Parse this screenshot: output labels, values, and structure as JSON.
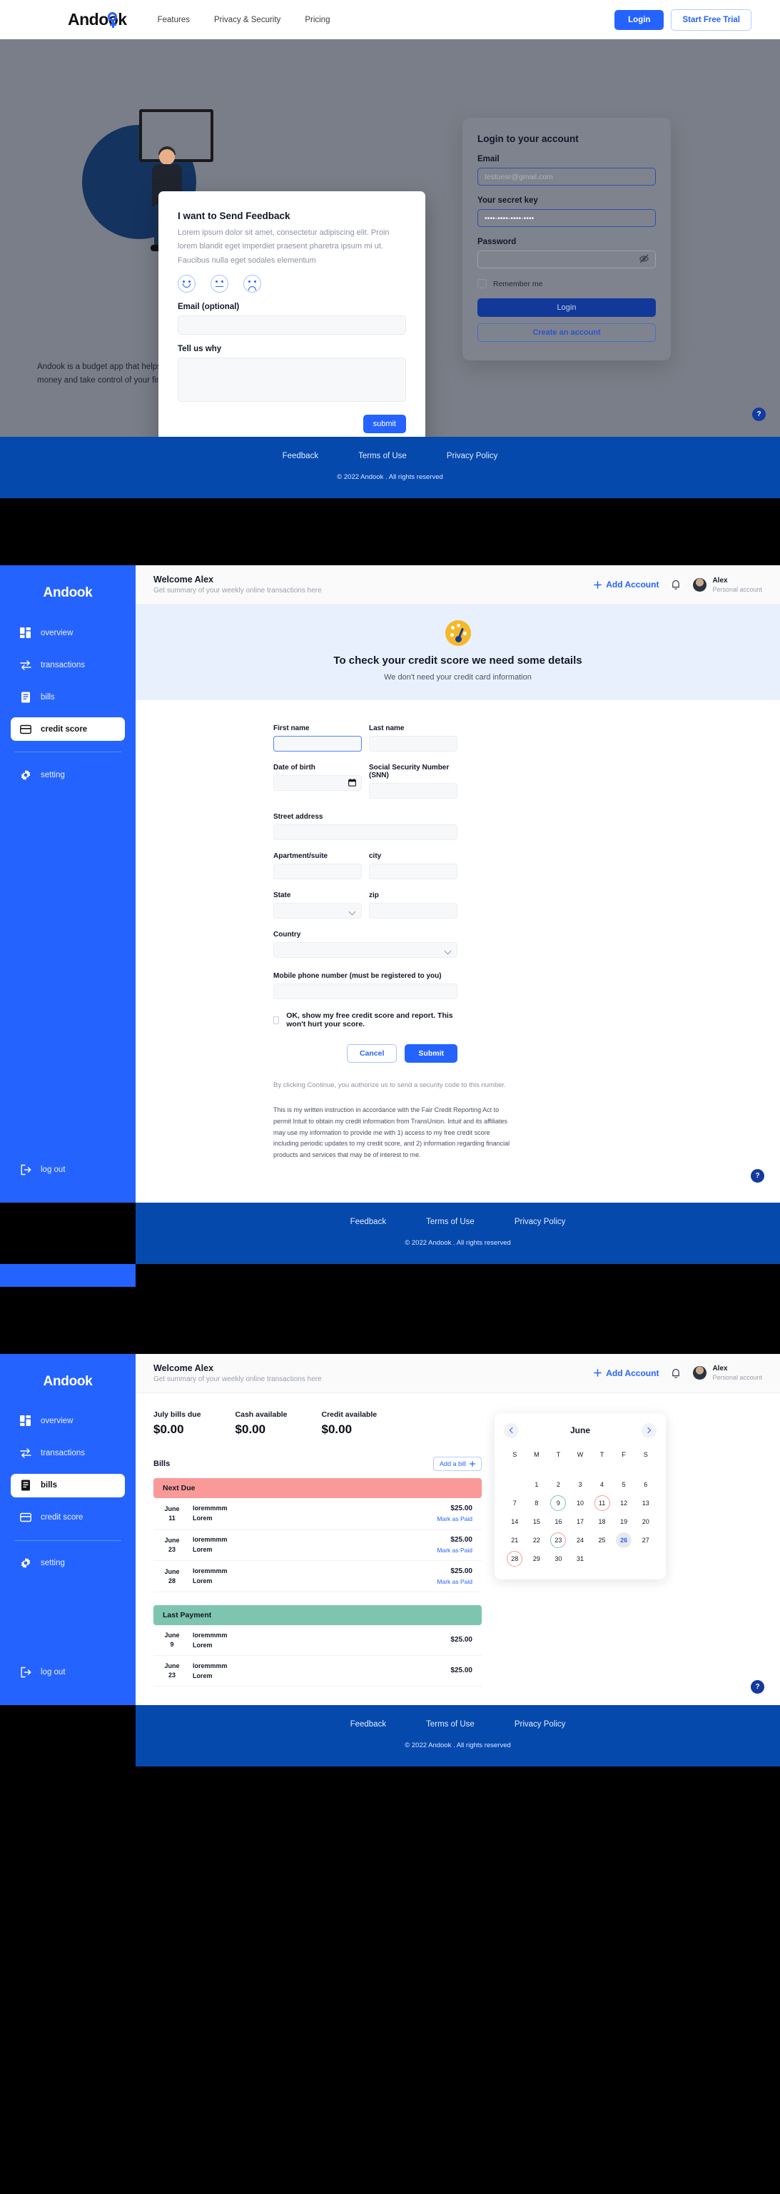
{
  "landing": {
    "brand": "Andook",
    "nav": [
      {
        "label": "Features"
      },
      {
        "label": "Privacy & Security"
      },
      {
        "label": "Pricing"
      }
    ],
    "login_button": "Login",
    "trial_button": "Start Free Trial",
    "hero_copy": "Andook is a budget app that helps you confidently spend your money and take control of your finances.",
    "help_label": "?"
  },
  "feedback": {
    "title": "I want to Send Feedback",
    "description": "Lorem ipsum dolor sit amet, consectetur adipiscing elit. Proin lorem blandit eget imperdiet praesent pharetra ipsum mi ut. Faucibus nulla eget sodales elementum",
    "email_label": "Email (optional)",
    "email_value": "",
    "why_label": "Tell us why",
    "why_value": "",
    "submit_label": "submit",
    "faces": [
      "happy-face",
      "neutral-face",
      "sad-face"
    ]
  },
  "login_card": {
    "title": "Login to your account",
    "email_label": "Email",
    "email_placeholder": "testuesr@gmail.com",
    "email_value": "",
    "secret_label": "Your secret key",
    "secret_value": "••••-••••-••••-••••",
    "password_label": "Password",
    "password_value": "",
    "remember_label": "Remember me",
    "login_button": "Login",
    "create_button": "Create an account"
  },
  "footer": {
    "links": [
      "Feedback",
      "Terms of Use",
      "Privacy Policy"
    ],
    "copyright": "© 2022 Andook . All rights reserved"
  },
  "dashboard": {
    "brand": "Andook",
    "nav_items": [
      {
        "label": "overview",
        "icon": "grid-icon"
      },
      {
        "label": "transactions",
        "icon": "transfer-icon"
      },
      {
        "label": "bills",
        "icon": "document-icon"
      },
      {
        "label": "credit score",
        "icon": "credit-card-icon"
      },
      {
        "label": "setting",
        "icon": "gear-icon"
      }
    ],
    "logout_label": "log out",
    "header": {
      "title": "Welcome Alex",
      "subtitle": "Get summary of your weekly online transactions here",
      "add_account": "Add Account",
      "user_name": "Alex",
      "user_type": "Personal account"
    }
  },
  "credit_score": {
    "active_nav": "credit score",
    "banner_title": "To check your credit score we need some details",
    "banner_subtitle": "We don't need your credit card information",
    "fields": {
      "first_name": {
        "label": "First name",
        "value": ""
      },
      "last_name": {
        "label": "Last name",
        "value": ""
      },
      "date_of_birth": {
        "label": "Date of birth",
        "value": ""
      },
      "ssn": {
        "label": "Social Security Number (SNN)",
        "value": ""
      },
      "street_address": {
        "label": "Street address",
        "value": ""
      },
      "apartment": {
        "label": "Apartment/suite",
        "value": ""
      },
      "city": {
        "label": "city",
        "value": ""
      },
      "state": {
        "label": "State",
        "value": ""
      },
      "zip": {
        "label": "zip",
        "value": ""
      },
      "country": {
        "label": "Country",
        "value": ""
      },
      "mobile": {
        "label": "Mobile phone number (must be registered to you)",
        "value": ""
      }
    },
    "consent_label": "OK, show my free credit score and report. This won't hurt your score.",
    "cancel_button": "Cancel",
    "submit_button": "Submit",
    "legal_short": "By clicking Continue, you authorize us to send a security code to this number.",
    "legal_long": "This is my written instruction in accordance with the Fair Credit Reporting Act to permit Intuit to obtain my credit information from TransUnion. Intuit and its affiliates may use my information to provide me with 1) access to my free credit score including periodic updates to my credit score, and 2) information regarding financial products and services that may be of interest to me."
  },
  "bills_page": {
    "active_nav": "bills",
    "stats": [
      {
        "label": "July bills due",
        "value": "$0.00"
      },
      {
        "label": "Cash available",
        "value": "$0.00"
      },
      {
        "label": "Credit available",
        "value": "$0.00"
      }
    ],
    "section_title": "Bills",
    "add_bill_label": "Add a bill",
    "groups": [
      {
        "title": "Next Due",
        "kind": "due",
        "rows": [
          {
            "month": "June",
            "day": "11",
            "name1": "loremmmm",
            "name2": "Lorem",
            "amount": "$25.00",
            "action": "Mark as Paid"
          },
          {
            "month": "June",
            "day": "23",
            "name1": "loremmmm",
            "name2": "Lorem",
            "amount": "$25.00",
            "action": "Mark as Paid"
          },
          {
            "month": "June",
            "day": "28",
            "name1": "loremmmm",
            "name2": "Lorem",
            "amount": "$25.00",
            "action": "Mark as Paid"
          }
        ]
      },
      {
        "title": "Last Payment",
        "kind": "paid",
        "rows": [
          {
            "month": "June",
            "day": "9",
            "name1": "loremmmm",
            "name2": "Lorem",
            "amount": "$25.00",
            "action": ""
          },
          {
            "month": "June",
            "day": "23",
            "name1": "loremmmm",
            "name2": "Lorem",
            "amount": "$25.00",
            "action": ""
          }
        ]
      }
    ],
    "calendar": {
      "month": "June",
      "dow": [
        "S",
        "M",
        "T",
        "W",
        "T",
        "F",
        "S"
      ],
      "lead_blanks": 1,
      "days": [
        1,
        2,
        3,
        4,
        5,
        6,
        7,
        8,
        9,
        10,
        11,
        12,
        13,
        14,
        15,
        16,
        17,
        18,
        19,
        20,
        21,
        22,
        23,
        24,
        25,
        26,
        27,
        28,
        29,
        30,
        31
      ],
      "marks": {
        "9": "green",
        "11": "red",
        "23": "redgreen",
        "26": "today",
        "28": "red"
      }
    }
  },
  "colors": {
    "brand_blue": "#2563ff",
    "footer_blue": "#0549ad",
    "deep_blue": "#12399a",
    "due_red": "#f99a98",
    "paid_green": "#7ec5b0",
    "banner_bg": "#e8f0fe",
    "gauge_yellow": "#f5b828"
  }
}
